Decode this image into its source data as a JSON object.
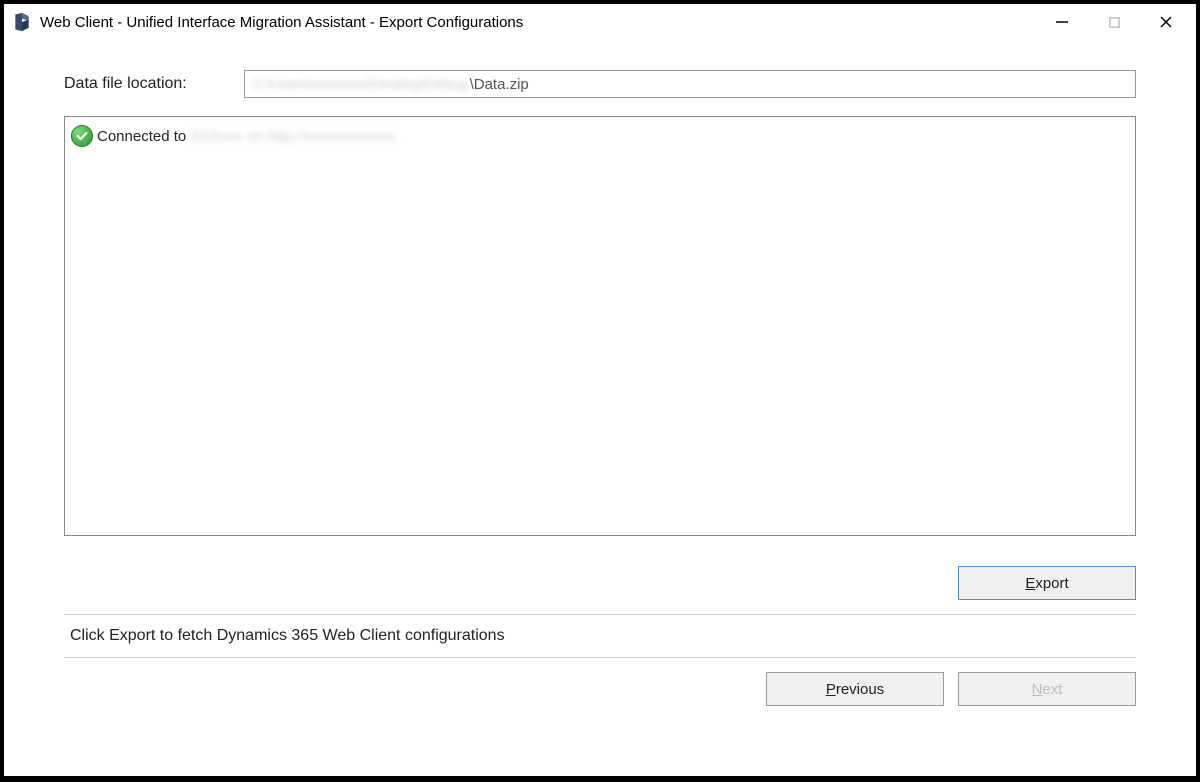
{
  "titlebar": {
    "title": "Web Client - Unified Interface Migration Assistant - Export Configurations"
  },
  "main": {
    "data_file_label": "Data file location:",
    "data_file_path_redacted": "C:\\Users\\xxxxxxxx\\Desktop\\Debug",
    "data_file_path_suffix": "\\Data.zip",
    "log": {
      "connected_prefix": "Connected to",
      "connected_target_redacted": "XXXxxx on http://xxxxxxxxxxxx"
    },
    "export_button": "Export",
    "hint": "Click Export to fetch Dynamics 365 Web Client configurations",
    "previous_button": "Previous",
    "next_button": "Next"
  }
}
